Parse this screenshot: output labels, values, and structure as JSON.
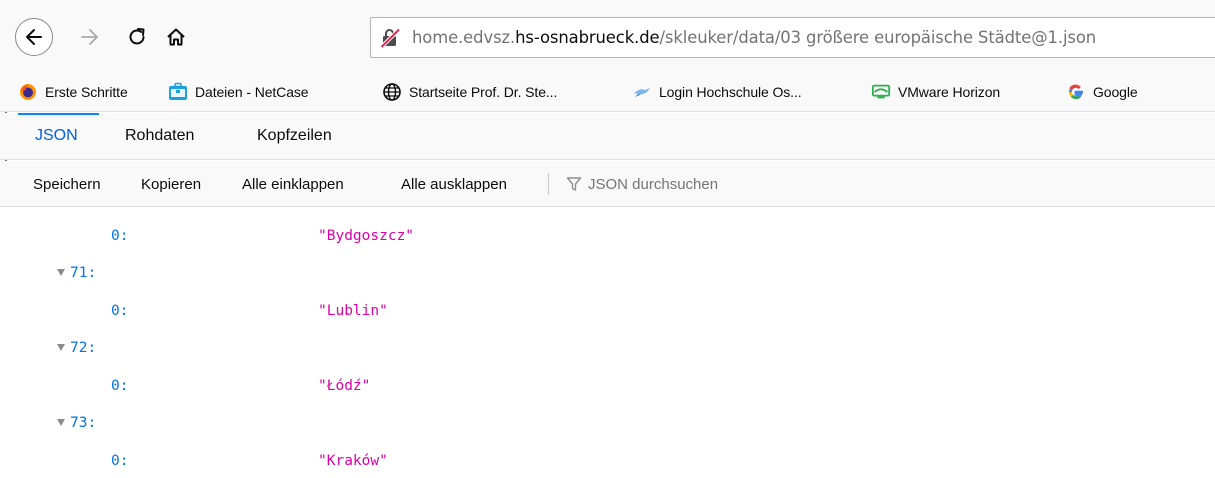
{
  "navbar": {
    "back_icon": "back-arrow-icon",
    "forward_icon": "forward-arrow-icon",
    "reload_icon": "reload-icon",
    "home_icon": "home-icon",
    "url_prefix": "home.edvsz.",
    "url_host": "hs-osnabrueck.de",
    "url_path": "/skleuker/data/03 größere europäische Städte@1.json"
  },
  "bookmarks": [
    {
      "label": "Erste Schritte",
      "icon": "firefox-icon"
    },
    {
      "label": "Dateien - NetCase",
      "icon": "briefcase-icon"
    },
    {
      "label": "Startseite Prof. Dr. Ste...",
      "icon": "globe-icon"
    },
    {
      "label": "Login Hochschule Os...",
      "icon": "bird-icon"
    },
    {
      "label": "VMware Horizon",
      "icon": "vmware-icon"
    },
    {
      "label": "Google",
      "icon": "google-icon"
    }
  ],
  "tabs": [
    {
      "label": "JSON",
      "selected": true
    },
    {
      "label": "Rohdaten",
      "selected": false
    },
    {
      "label": "Kopfzeilen",
      "selected": false
    }
  ],
  "toolbar": {
    "save": "Speichern",
    "copy": "Kopieren",
    "collapse_all": "Alle einklappen",
    "expand_all": "Alle ausklappen",
    "filter_placeholder": "JSON durchsuchen"
  },
  "rows": [
    {
      "key": "0:",
      "value": "\"Bydgoszcz\""
    },
    {
      "key": "71:",
      "value": ""
    },
    {
      "key": "0:",
      "value": "\"Lublin\""
    },
    {
      "key": "72:",
      "value": ""
    },
    {
      "key": "0:",
      "value": "\"Łódź\""
    },
    {
      "key": "73:",
      "value": ""
    },
    {
      "key": "0:",
      "value": "\"Kraków\""
    }
  ],
  "colors": {
    "accent": "#0a84ff",
    "json_key": "#0074e8",
    "json_string": "#dd00a9"
  }
}
